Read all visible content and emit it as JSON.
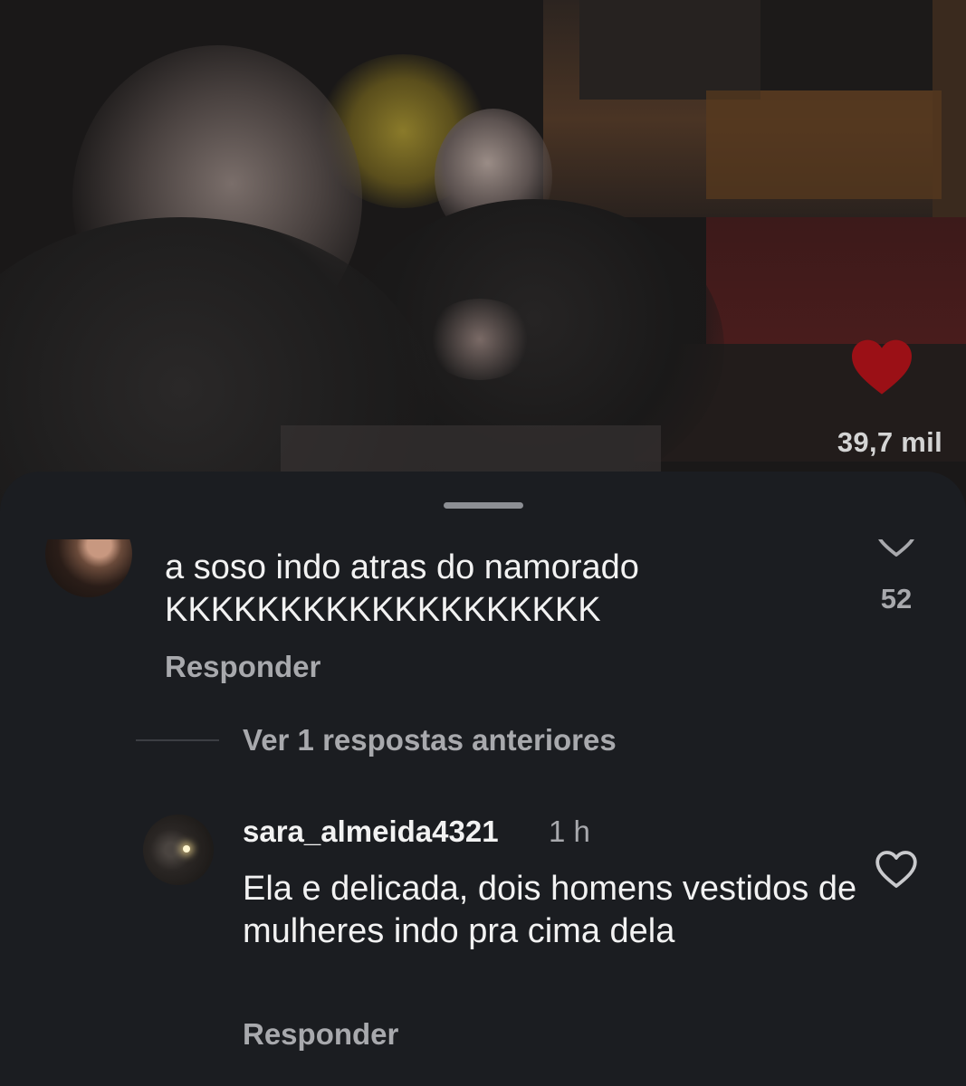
{
  "video": {
    "like_count": "39,7 mil",
    "like_icon": "heart-filled-icon",
    "like_color": "#9b1016"
  },
  "comments": [
    {
      "text": "a soso indo atras do namorado KKKKKKKKKKKKKKKKKKK",
      "reply_label": "Responder",
      "like_count": "52",
      "like_icon": "heart-outline-icon"
    },
    {
      "username": "sara_almeida4321",
      "time": "1 h",
      "text": "Ela e delicada, dois homens vestidos de mulheres indo pra cima dela",
      "reply_label": "Responder",
      "like_icon": "heart-outline-icon"
    }
  ],
  "view_previous_replies": "Ver 1 respostas anteriores",
  "colors": {
    "sheet_background": "#1b1d21",
    "primary_text": "#f2f2f2",
    "secondary_text": "#a8a9ad"
  }
}
